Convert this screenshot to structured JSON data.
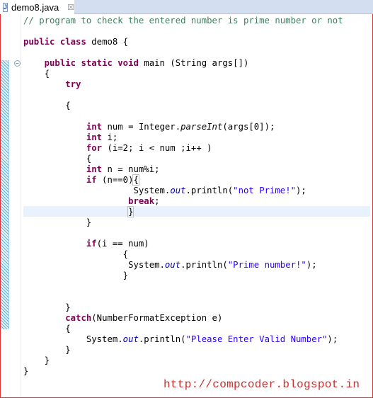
{
  "editor": {
    "tab": {
      "filename": "demo8.java",
      "icon": "java-file-icon",
      "close_icon": "close-icon"
    },
    "fold_icon": "collapse-icon",
    "lines": [
      {
        "indent": "",
        "parts": [
          {
            "t": "// program to check the entered number is prime number or not",
            "c": "cm"
          }
        ]
      },
      {
        "indent": "",
        "parts": []
      },
      {
        "indent": "",
        "parts": [
          {
            "t": "public",
            "c": "kw"
          },
          {
            "t": " "
          },
          {
            "t": "class",
            "c": "kw"
          },
          {
            "t": " demo8 {"
          }
        ]
      },
      {
        "indent": "",
        "parts": []
      },
      {
        "indent": "    ",
        "parts": [
          {
            "t": "public",
            "c": "kw"
          },
          {
            "t": " "
          },
          {
            "t": "static",
            "c": "kw"
          },
          {
            "t": " "
          },
          {
            "t": "void",
            "c": "kw"
          },
          {
            "t": " main (String args[])"
          }
        ]
      },
      {
        "indent": "    ",
        "parts": [
          {
            "t": "{"
          }
        ]
      },
      {
        "indent": "        ",
        "parts": [
          {
            "t": "try",
            "c": "kw"
          }
        ]
      },
      {
        "indent": "",
        "parts": []
      },
      {
        "indent": "        ",
        "parts": [
          {
            "t": "{"
          }
        ]
      },
      {
        "indent": "",
        "parts": []
      },
      {
        "indent": "            ",
        "parts": [
          {
            "t": "int",
            "c": "kw"
          },
          {
            "t": " num = Integer."
          },
          {
            "t": "parseInt",
            "c": "it-black"
          },
          {
            "t": "(args[0]);"
          }
        ]
      },
      {
        "indent": "            ",
        "parts": [
          {
            "t": "int",
            "c": "kw"
          },
          {
            "t": " i;"
          }
        ]
      },
      {
        "indent": "            ",
        "parts": [
          {
            "t": "for",
            "c": "kw"
          },
          {
            "t": " (i=2; i < num ;i++ )"
          }
        ]
      },
      {
        "indent": "            ",
        "parts": [
          {
            "t": "{"
          }
        ]
      },
      {
        "indent": "            ",
        "parts": [
          {
            "t": "int",
            "c": "kw"
          },
          {
            "t": " n = num%i;"
          }
        ]
      },
      {
        "indent": "            ",
        "parts": [
          {
            "t": "if",
            "c": "kw"
          },
          {
            "t": " (n==0)"
          },
          {
            "t": "{",
            "c": "bracket"
          }
        ]
      },
      {
        "indent": "                     ",
        "parts": [
          {
            "t": "System."
          },
          {
            "t": "out",
            "c": "it"
          },
          {
            "t": ".println("
          },
          {
            "t": "\"not Prime!\"",
            "c": "st"
          },
          {
            "t": ");"
          }
        ]
      },
      {
        "indent": "                    ",
        "parts": [
          {
            "t": "break",
            "c": "kw"
          },
          {
            "t": ";"
          }
        ]
      },
      {
        "indent": "                    ",
        "parts": [
          {
            "t": "}",
            "c": "bracket"
          },
          {
            "t": "",
            "c": "caret"
          }
        ]
      },
      {
        "indent": "            ",
        "parts": [
          {
            "t": "}"
          }
        ]
      },
      {
        "indent": "",
        "parts": []
      },
      {
        "indent": "            ",
        "parts": [
          {
            "t": "if",
            "c": "kw"
          },
          {
            "t": "(i == num)"
          }
        ]
      },
      {
        "indent": "                   ",
        "parts": [
          {
            "t": "{"
          }
        ]
      },
      {
        "indent": "                    ",
        "parts": [
          {
            "t": "System."
          },
          {
            "t": "out",
            "c": "it"
          },
          {
            "t": ".println("
          },
          {
            "t": "\"Prime number!\"",
            "c": "st"
          },
          {
            "t": ");"
          }
        ]
      },
      {
        "indent": "                   ",
        "parts": [
          {
            "t": "}"
          }
        ]
      },
      {
        "indent": "",
        "parts": []
      },
      {
        "indent": "",
        "parts": []
      },
      {
        "indent": "        ",
        "parts": [
          {
            "t": "}"
          }
        ]
      },
      {
        "indent": "        ",
        "parts": [
          {
            "t": "catch",
            "c": "kw"
          },
          {
            "t": "(NumberFormatException e)"
          }
        ]
      },
      {
        "indent": "        ",
        "parts": [
          {
            "t": "{"
          }
        ]
      },
      {
        "indent": "            ",
        "parts": [
          {
            "t": "System."
          },
          {
            "t": "out",
            "c": "it"
          },
          {
            "t": ".println("
          },
          {
            "t": "\"Please Enter Valid Number\"",
            "c": "st"
          },
          {
            "t": ");"
          }
        ]
      },
      {
        "indent": "        ",
        "parts": [
          {
            "t": "}"
          }
        ]
      },
      {
        "indent": "    ",
        "parts": [
          {
            "t": "}"
          }
        ]
      },
      {
        "indent": "",
        "parts": [
          {
            "t": "}"
          }
        ]
      }
    ]
  },
  "watermark": "http://compcoder.blogspot.in"
}
